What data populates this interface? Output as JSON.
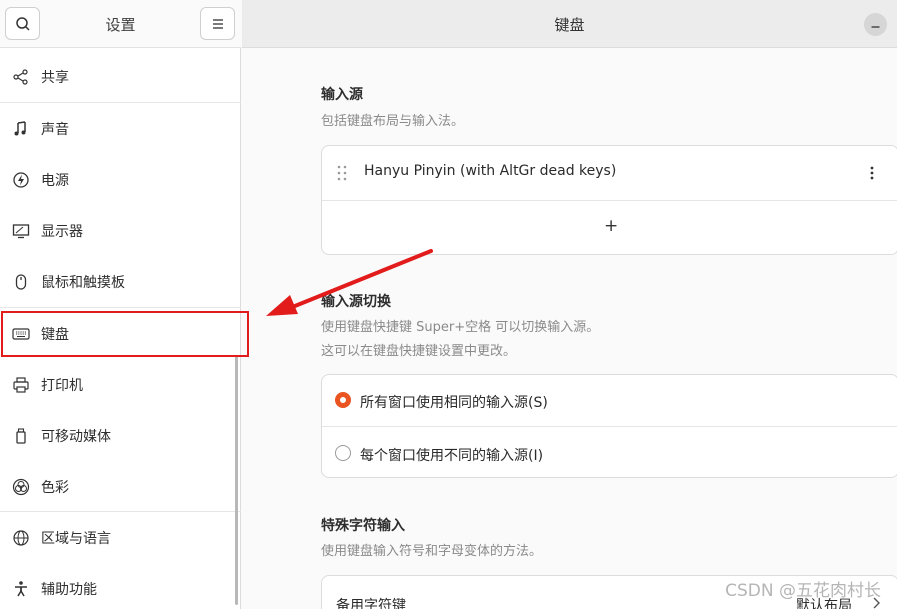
{
  "sidebar": {
    "title": "设置",
    "items": [
      {
        "label": "共享",
        "icon": "share-icon"
      },
      {
        "label": "声音",
        "icon": "music-note-icon"
      },
      {
        "label": "电源",
        "icon": "power-icon"
      },
      {
        "label": "显示器",
        "icon": "display-icon"
      },
      {
        "label": "鼠标和触摸板",
        "icon": "mouse-icon"
      },
      {
        "label": "键盘",
        "icon": "keyboard-icon"
      },
      {
        "label": "打印机",
        "icon": "printer-icon"
      },
      {
        "label": "可移动媒体",
        "icon": "removable-media-icon"
      },
      {
        "label": "色彩",
        "icon": "color-icon"
      },
      {
        "label": "区域与语言",
        "icon": "globe-icon"
      },
      {
        "label": "辅助功能",
        "icon": "accessibility-icon"
      }
    ]
  },
  "header": {
    "title": "键盘"
  },
  "input_sources": {
    "title": "输入源",
    "subtitle": "包括键盘布局与输入法。",
    "items": [
      "Hanyu Pinyin (with AltGr dead keys)"
    ],
    "add_symbol": "+"
  },
  "switching": {
    "title": "输入源切换",
    "subtitle_line1": "使用键盘快捷键 Super+空格 可以切换输入源。",
    "subtitle_line2": "这可以在键盘快捷键设置中更改。",
    "options": [
      {
        "label": "所有窗口使用相同的输入源(S)",
        "selected": true
      },
      {
        "label": "每个窗口使用不同的输入源(I)",
        "selected": false
      }
    ]
  },
  "special_chars": {
    "title": "特殊字符输入",
    "subtitle": "使用键盘输入符号和字母变体的方法。",
    "row_label": "备用字符键",
    "row_value": "默认布局"
  },
  "watermark": "CSDN @五花肉村长",
  "colors": {
    "accent": "#e95420",
    "annotation": "#e21b1b"
  }
}
